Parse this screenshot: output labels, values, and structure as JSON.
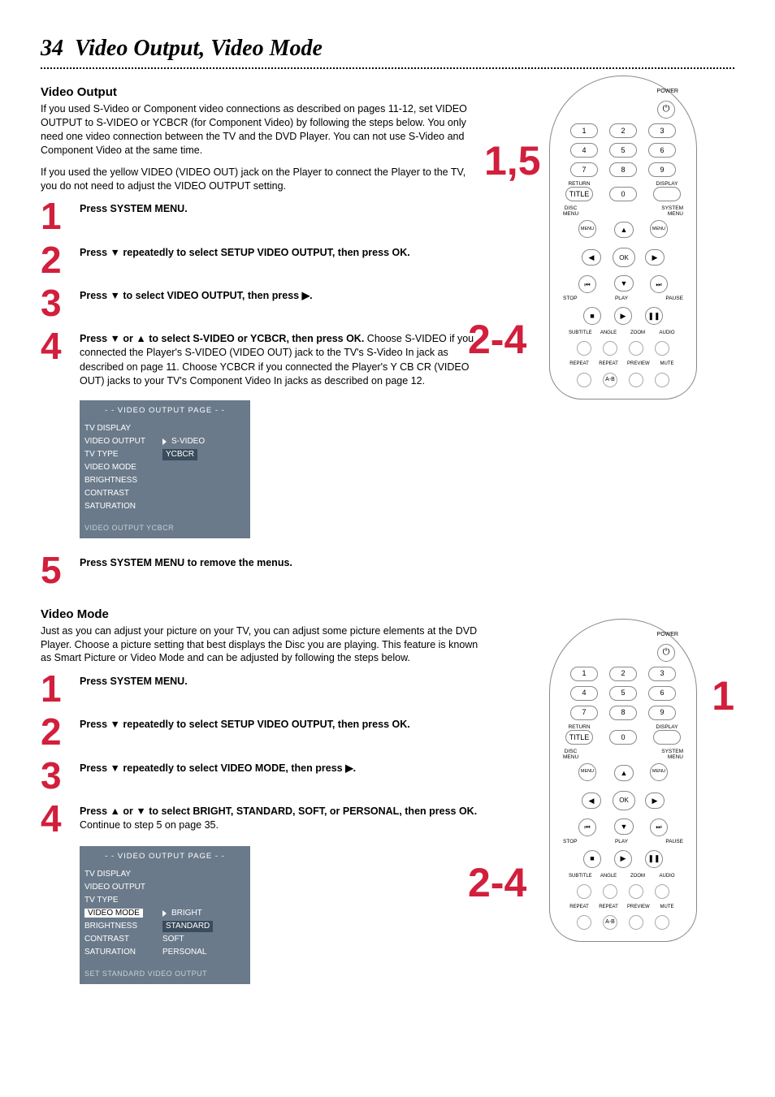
{
  "page": {
    "number": "34",
    "title_rest": "Video Output, Video Mode"
  },
  "video_output": {
    "heading": "Video Output",
    "intro1": "If you used S-Video or Component video connections as described on pages 11-12, set VIDEO OUTPUT to S-VIDEO or YCBCR (for Component Video) by following the steps below. You only need one video connection between the TV and the DVD Player. You can not use S-Video and Component Video at the same time.",
    "intro2": "If you used the yellow VIDEO (VIDEO OUT) jack on the Player to connect the Player to the TV, you do not need to adjust the VIDEO OUTPUT setting.",
    "steps": {
      "s1": "Press SYSTEM MENU.",
      "s2a": "Press ▼ repeatedly to select SETUP VIDEO OUTPUT, then press OK.",
      "s3a": "Press ▼ to select VIDEO OUTPUT, then press ▶.",
      "s4a": "Press ▼ or ▲ to select S-VIDEO or YCBCR, then press OK.",
      "s4b": "Choose S-VIDEO if you connected the Player's S-VIDEO (VIDEO OUT) jack to the TV's S-Video In jack as described on page 11. Choose YCBCR if you connected the Player's Y CB CR (VIDEO OUT) jacks to your TV's Component Video In jacks as described on page 12.",
      "s5": "Press SYSTEM MENU to remove the menus."
    },
    "menu": {
      "title": "- -  VIDEO OUTPUT PAGE  - -",
      "items": [
        "TV DISPLAY",
        "VIDEO OUTPUT",
        "TV TYPE",
        "VIDEO MODE",
        "BRIGHTNESS",
        "CONTRAST",
        "SATURATION"
      ],
      "sel_value": "S-VIDEO",
      "hl_value": "YCBCR",
      "footer": "VIDEO OUTPUT YCBCR"
    }
  },
  "video_mode": {
    "heading": "Video Mode",
    "intro": "Just as you can adjust your picture on your TV, you can adjust some picture elements at the DVD Player. Choose a picture setting that best displays the Disc you are playing. This feature is known as Smart Picture or Video Mode and can be adjusted by following the steps below.",
    "steps": {
      "s1": "Press SYSTEM MENU.",
      "s2": "Press ▼ repeatedly to select SETUP VIDEO OUTPUT, then press OK.",
      "s3": "Press ▼ repeatedly to select VIDEO MODE, then press ▶.",
      "s4a": "Press ▲ or ▼ to select BRIGHT, STANDARD, SOFT, or PERSONAL, then press OK.",
      "s4b": " Continue to step 5 on page 35."
    },
    "menu": {
      "title": "- -  VIDEO OUTPUT PAGE  - -",
      "items": [
        "TV DISPLAY",
        "VIDEO OUTPUT",
        "TV TYPE",
        "VIDEO MODE",
        "BRIGHTNESS",
        "CONTRAST",
        "SATURATION"
      ],
      "options": [
        "BRIGHT",
        "STANDARD",
        "SOFT",
        "PERSONAL"
      ],
      "footer": "SET STANDARD VIDEO OUTPUT"
    }
  },
  "remote": {
    "power": "POWER",
    "numbers_r1": [
      "1",
      "2",
      "3"
    ],
    "numbers_r2": [
      "4",
      "5",
      "6"
    ],
    "numbers_r3": [
      "7",
      "8",
      "9"
    ],
    "zero": "0",
    "return": "RETURN",
    "title_btn": "TITLE",
    "display": "DISPLAY",
    "disc_menu": "DISC\nMENU",
    "system_menu": "SYSTEM\nMENU",
    "menu_l": "MENU",
    "menu_r": "MENU",
    "ok": "OK",
    "stop": "STOP",
    "play": "PLAY",
    "pause": "PAUSE",
    "sub_labels": [
      "SUBTITLE",
      "ANGLE",
      "ZOOM",
      "AUDIO"
    ],
    "sub_labels2": [
      "REPEAT",
      "REPEAT",
      "PREVIEW",
      "MUTE"
    ],
    "ab": "A-B",
    "callout1": "1,5",
    "callout2": "2-4",
    "callout3": "1",
    "callout4": "2-4"
  }
}
